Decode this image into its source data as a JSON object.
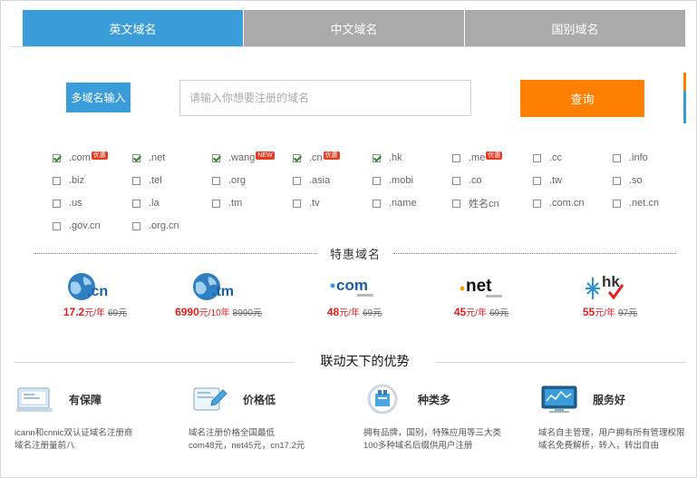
{
  "tabs": [
    {
      "label": "英文域名",
      "active": true
    },
    {
      "label": "中文域名",
      "active": false
    },
    {
      "label": "国别域名",
      "active": false
    }
  ],
  "search": {
    "multi_button": "多域名输入",
    "placeholder": "请输入你想要注册的域名",
    "query_button": "查询"
  },
  "tlds": [
    {
      "label": ".com",
      "checked": true,
      "badge": "优惠"
    },
    {
      "label": ".net",
      "checked": true,
      "badge": ""
    },
    {
      "label": ".wang",
      "checked": true,
      "badge": "NEW"
    },
    {
      "label": ".cn",
      "checked": true,
      "badge": "优惠"
    },
    {
      "label": ".hk",
      "checked": true,
      "badge": ""
    },
    {
      "label": ".me",
      "checked": false,
      "badge": "优惠"
    },
    {
      "label": ".cc",
      "checked": false,
      "badge": ""
    },
    {
      "label": ".info",
      "checked": false,
      "badge": ""
    },
    {
      "label": ".biz",
      "checked": false,
      "badge": ""
    },
    {
      "label": ".tel",
      "checked": false,
      "badge": ""
    },
    {
      "label": ".org",
      "checked": false,
      "badge": ""
    },
    {
      "label": ".asia",
      "checked": false,
      "badge": ""
    },
    {
      "label": ".mobi",
      "checked": false,
      "badge": ""
    },
    {
      "label": ".co",
      "checked": false,
      "badge": ""
    },
    {
      "label": ".tw",
      "checked": false,
      "badge": ""
    },
    {
      "label": ".so",
      "checked": false,
      "badge": ""
    },
    {
      "label": ".us",
      "checked": false,
      "badge": ""
    },
    {
      "label": ".la",
      "checked": false,
      "badge": ""
    },
    {
      "label": ".tm",
      "checked": false,
      "badge": ""
    },
    {
      "label": ".tv",
      "checked": false,
      "badge": ""
    },
    {
      "label": ".name",
      "checked": false,
      "badge": ""
    },
    {
      "label": "姓名cn",
      "checked": false,
      "badge": ""
    },
    {
      "label": ".com.cn",
      "checked": false,
      "badge": ""
    },
    {
      "label": ".net.cn",
      "checked": false,
      "badge": ""
    },
    {
      "label": ".gov.cn",
      "checked": false,
      "badge": ""
    },
    {
      "label": ".org.cn",
      "checked": false,
      "badge": ""
    }
  ],
  "special": {
    "title": "特惠域名",
    "deals": [
      {
        "logo": ".cn",
        "price": "17.2",
        "unit": "元/年",
        "old": "69元"
      },
      {
        "logo": ".tm",
        "price": "6990",
        "unit": "元/10年",
        "old": "8990元"
      },
      {
        "logo": ".com",
        "price": "48",
        "unit": "元/年",
        "old": "69元"
      },
      {
        "logo": ".net",
        "price": "45",
        "unit": "元/年",
        "old": "69元"
      },
      {
        "logo": "hk",
        "price": "55",
        "unit": "元/年",
        "old": "97元"
      }
    ]
  },
  "advantages": {
    "title": "联动天下的优势",
    "items": [
      {
        "title": "有保障",
        "icon": "monitor-icon",
        "desc1": "icann和cnnic双认证域名注册商",
        "desc2": "域名注册量前八"
      },
      {
        "title": "价格低",
        "icon": "price-tag-icon",
        "desc1": "域名注册价格全国最低",
        "desc2": "com48元，net45元，cn17.2元"
      },
      {
        "title": "种类多",
        "icon": "variety-icon",
        "desc1": "拥有品牌，国别，特殊应用等三大类",
        "desc2": "100多种域名后缀供用户注册"
      },
      {
        "title": "服务好",
        "icon": "screen-service-icon",
        "desc1": "域名自主管理，用户拥有所有管理权限",
        "desc2": "域名免费解析，转入，转出自由"
      }
    ]
  },
  "colors": {
    "accent_blue": "#3a9cd9",
    "accent_orange": "#ff7f00",
    "tab_inactive": "#aaaaaa",
    "price_red": "#e02020"
  }
}
